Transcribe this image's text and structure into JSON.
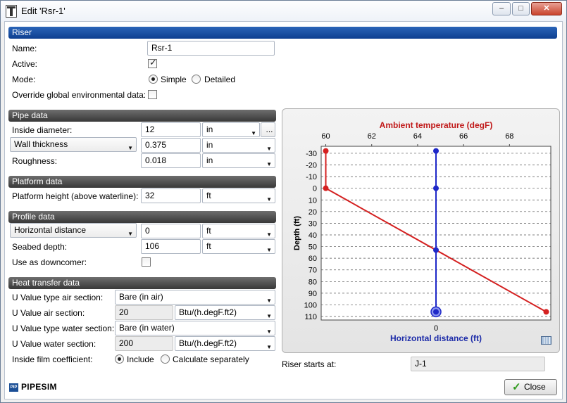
{
  "window": {
    "title": "Edit 'Rsr-1'",
    "buttons": {
      "minimize": "–",
      "maximize": "□",
      "close": "✕"
    }
  },
  "riser": {
    "header": "Riser",
    "name_label": "Name:",
    "name_value": "Rsr-1",
    "active_label": "Active:",
    "active_checked": true,
    "mode_label": "Mode:",
    "mode_simple": "Simple",
    "mode_detailed": "Detailed",
    "mode_selected": "Simple",
    "override_label": "Override global environmental data:",
    "override_checked": false
  },
  "pipe": {
    "header": "Pipe data",
    "inside_diameter_label": "Inside diameter:",
    "inside_diameter_value": "12",
    "inside_diameter_unit": "in",
    "browse": "...",
    "wall_select": "Wall thickness",
    "wall_value": "0.375",
    "wall_unit": "in",
    "roughness_label": "Roughness:",
    "roughness_value": "0.018",
    "roughness_unit": "in"
  },
  "platform": {
    "header": "Platform data",
    "height_label": "Platform height (above waterline):",
    "height_value": "32",
    "height_unit": "ft"
  },
  "profile": {
    "header": "Profile data",
    "distance_select": "Horizontal distance",
    "distance_value": "0",
    "distance_unit": "ft",
    "seabed_label": "Seabed depth:",
    "seabed_value": "106",
    "seabed_unit": "ft",
    "downcomer_label": "Use as downcomer:",
    "downcomer_checked": false
  },
  "heat": {
    "header": "Heat transfer data",
    "air_type_label": "U Value type air section:",
    "air_type_value": "Bare (in air)",
    "air_value_label": "U Value air section:",
    "air_value": "20",
    "air_unit": "Btu/(h.degF.ft2)",
    "water_type_label": "U Value type water section:",
    "water_type_value": "Bare (in water)",
    "water_value_label": "U Value water section:",
    "water_value": "200",
    "water_unit": "Btu/(h.degF.ft2)",
    "film_label": "Inside film coefficient:",
    "film_include": "Include",
    "film_calc": "Calculate separately",
    "film_selected": "Include"
  },
  "riser_start": {
    "label": "Riser starts at:",
    "value": "J-1"
  },
  "footer": {
    "brand": "PIPESIM",
    "logo_text": "PIP",
    "close_label": "Close"
  },
  "colors": {
    "temperature": "#d42020",
    "distance": "#1e28c8",
    "riser_band": "#1a4fa3",
    "section_band": "#4a4a4a"
  },
  "icons": [
    "app-icon",
    "minimize-icon",
    "maximize-icon",
    "close-icon",
    "check-icon",
    "table-grid-icon",
    "pipesim-logo-icon",
    "dropdown-arrow-icon"
  ],
  "chart_data": {
    "type": "line",
    "top_axis_label": "Ambient temperature (degF)",
    "bottom_axis_label": "Horizontal distance (ft)",
    "ylabel": "Depth (ft)",
    "top_ticks": [
      "60",
      "62",
      "64",
      "66",
      "68"
    ],
    "top_xlim": [
      59.8,
      69.8
    ],
    "bottom_ticks": [
      "0"
    ],
    "y_ticks": [
      "-30",
      "-20",
      "-10",
      "0",
      "10",
      "20",
      "30",
      "40",
      "50",
      "60",
      "70",
      "80",
      "90",
      "100",
      "110"
    ],
    "ylim": [
      -36,
      113
    ],
    "grid": true,
    "series": [
      {
        "name": "Ambient temperature (degF)",
        "color": "#d42020",
        "x": [
          60,
          60,
          69.6
        ],
        "y": [
          -32,
          0,
          106
        ]
      },
      {
        "name": "Horizontal distance (ft)",
        "color": "#1e28c8",
        "x": [
          0,
          0,
          0,
          0
        ],
        "y": [
          -32,
          0,
          53,
          106
        ]
      }
    ]
  }
}
